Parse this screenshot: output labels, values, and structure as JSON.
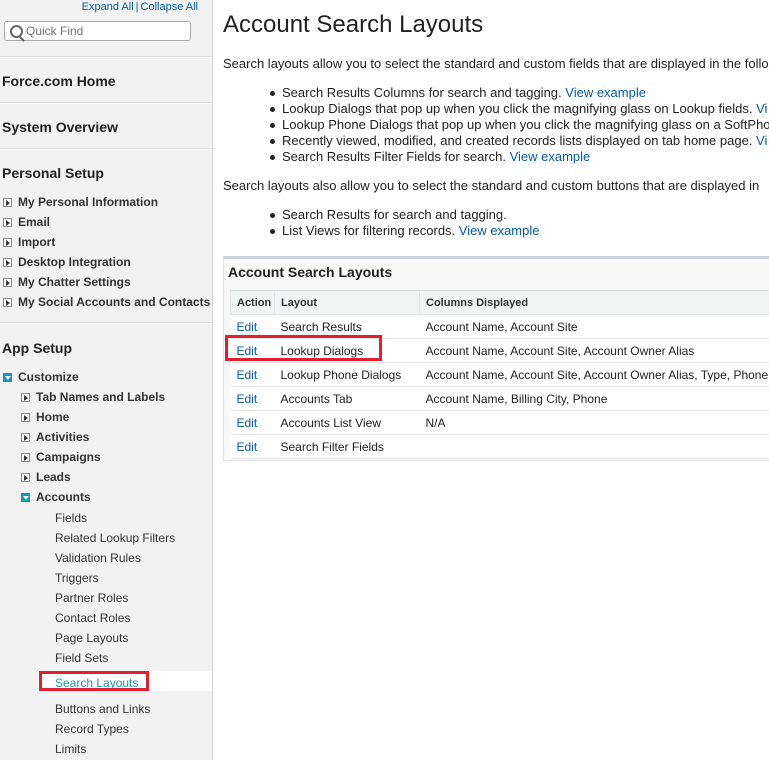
{
  "sidebar": {
    "expand_all": "Expand All",
    "separator": "|",
    "collapse_all": "Collapse All",
    "quick_find_placeholder": "Quick Find",
    "sections": {
      "force_home": "Force.com Home",
      "system_overview": "System Overview",
      "personal_setup": "Personal Setup",
      "app_setup": "App Setup"
    },
    "personal_items": [
      "My Personal Information",
      "Email",
      "Import",
      "Desktop Integration",
      "My Chatter Settings",
      "My Social Accounts and Contacts"
    ],
    "customize": "Customize",
    "customize_items": [
      "Tab Names and Labels",
      "Home",
      "Activities",
      "Campaigns",
      "Leads",
      "Accounts"
    ],
    "accounts_items": [
      "Fields",
      "Related Lookup Filters",
      "Validation Rules",
      "Triggers",
      "Partner Roles",
      "Contact Roles",
      "Page Layouts",
      "Field Sets",
      "Search Layouts",
      "Buttons and Links",
      "Record Types",
      "Limits"
    ],
    "selected_item": "Search Layouts"
  },
  "main": {
    "title": "Account Search Layouts",
    "intro_fields": "Search layouts allow you to select the standard and custom fields that are displayed in the follo",
    "field_bullets": [
      {
        "text": "Search Results Columns for search and tagging. ",
        "link": "View example"
      },
      {
        "text": "Lookup Dialogs that pop up when you click the magnifying glass on Lookup fields. ",
        "link": "Vi"
      },
      {
        "text": "Lookup Phone Dialogs that pop up when you click the magnifying glass on a SoftPho",
        "link": ""
      },
      {
        "text": "Recently viewed, modified, and created records lists displayed on tab home page. ",
        "link": "Vi"
      },
      {
        "text": "Search Results Filter Fields for search. ",
        "link": "View example"
      }
    ],
    "intro_buttons": "Search layouts also allow you to select the standard and custom buttons that are displayed in",
    "button_bullets": [
      {
        "text": "Search Results for search and tagging.",
        "link": ""
      },
      {
        "text": "List Views for filtering records. ",
        "link": "View example"
      }
    ],
    "panel_title": "Account Search Layouts",
    "table": {
      "headers": [
        "Action",
        "Layout",
        "Columns Displayed"
      ],
      "rows": [
        {
          "action": "Edit",
          "layout": "Search Results",
          "columns": "Account Name, Account Site"
        },
        {
          "action": "Edit",
          "layout": "Lookup Dialogs",
          "columns": "Account Name, Account Site, Account Owner Alias"
        },
        {
          "action": "Edit",
          "layout": "Lookup Phone Dialogs",
          "columns": "Account Name, Account Site, Account Owner Alias, Type, Phone"
        },
        {
          "action": "Edit",
          "layout": "Accounts Tab",
          "columns": "Account Name, Billing City, Phone"
        },
        {
          "action": "Edit",
          "layout": "Accounts List View",
          "columns": "N/A"
        },
        {
          "action": "Edit",
          "layout": "Search Filter Fields",
          "columns": ""
        }
      ]
    }
  },
  "colors": {
    "link": "#015ba7",
    "highlight_box": "#e0202e",
    "selected_text": "#1797c0",
    "tree_open": "#1797c0"
  }
}
